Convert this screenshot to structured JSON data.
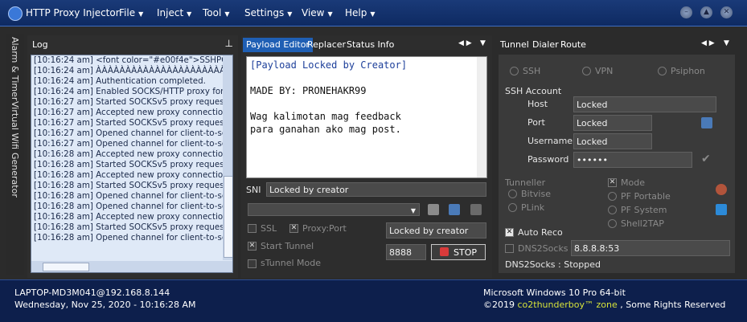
{
  "titlebar": {
    "app_title": "HTTP Proxy Injector",
    "menus": [
      {
        "label": "File"
      },
      {
        "label": "Inject"
      },
      {
        "label": "Tool"
      },
      {
        "label": "Settings"
      },
      {
        "label": "View"
      },
      {
        "label": "Help"
      }
    ]
  },
  "side_tabs": [
    "Alarm & Timer",
    "Virtual Wifi",
    "Generator"
  ],
  "log": {
    "title": "Log",
    "lines": [
      "[10:16:24 am] <font color=\"#e00f4e\">SSHPOW",
      "[10:16:24 am] ÀÀÀÀÀÀÀÀÀÀÀÀÀÀÀÀÀÀÀÀÀÀÀÀÀÀ",
      "[10:16:24 am] Authentication completed.",
      "[10:16:24 am] Enabled SOCKS/HTTP proxy forw",
      "[10:16:27 am] Started SOCKSv5 proxy request",
      "[10:16:27 am] Accepted new proxy connection",
      "[10:16:27 am] Started SOCKSv5 proxy request",
      "[10:16:27 am] Opened channel for client-to-ser",
      "[10:16:27 am] Opened channel for client-to-ser",
      "[10:16:28 am] Accepted new proxy connection",
      "[10:16:28 am] Started SOCKSv5 proxy request",
      "[10:16:28 am] Accepted new proxy connection",
      "[10:16:28 am] Started SOCKSv5 proxy request",
      "[10:16:28 am] Opened channel for client-to-ser",
      "[10:16:28 am] Opened channel for client-to-ser",
      "[10:16:28 am] Accepted new proxy connection",
      "[10:16:28 am] Started SOCKSv5 proxy request",
      "[10:16:28 am] Opened channel for client-to-ser"
    ]
  },
  "center": {
    "tabs": [
      "Payload Editor",
      "Replacer",
      "Status Info"
    ],
    "payload": {
      "line1": "[Payload Locked by Creator]",
      "line2": "MADE BY: PRONEHAKR99",
      "line3": "Wag kalimotan mag feedback",
      "line4": "para ganahan ako mag post."
    },
    "sni_label": "SNI",
    "sni_value": "Locked by creator",
    "ssl_label": "SSL",
    "proxy_port_label": "Proxy:Port",
    "proxy_value": "Locked by creator",
    "start_tunnel_label": "Start Tunnel",
    "stunnel_label": "sTunnel Mode",
    "port_value": "8888",
    "stop_label": "STOP"
  },
  "right": {
    "tabs": [
      "Tunnel",
      "Dialer",
      "Route"
    ],
    "modes": [
      "SSH",
      "VPN",
      "Psiphon"
    ],
    "ssh_account_label": "SSH Account",
    "host_label": "Host",
    "host_value": "Locked",
    "port_label": "Port",
    "port_value": "Locked",
    "username_label": "Username",
    "username_value": "Locked",
    "password_label": "Password",
    "password_value": "••••••",
    "tunneller_label": "Tunneller",
    "bitvise_label": "Bitvise",
    "plink_label": "PLink",
    "mode_label": "Mode",
    "pf_portable_label": "PF Portable",
    "pf_system_label": "PF System",
    "shell2tap_label": "Shell2TAP",
    "auto_reco_label": "Auto Reco",
    "dns2socks_label": "DNS2Socks",
    "dns_value": "8.8.8.8:53",
    "dns_status": "DNS2Socks : Stopped"
  },
  "statusbar": {
    "host": "LAPTOP-MD3M041@192.168.8.144",
    "datetime": "Wednesday, Nov 25, 2020 - 10:16:28 AM",
    "os": "Microsoft Windows 10 Pro 64-bit",
    "copyright_prefix": "©2019 ",
    "copyright_brand": "co2thunderboy™ zone",
    "copyright_suffix": " , Some Rights Reserved"
  }
}
